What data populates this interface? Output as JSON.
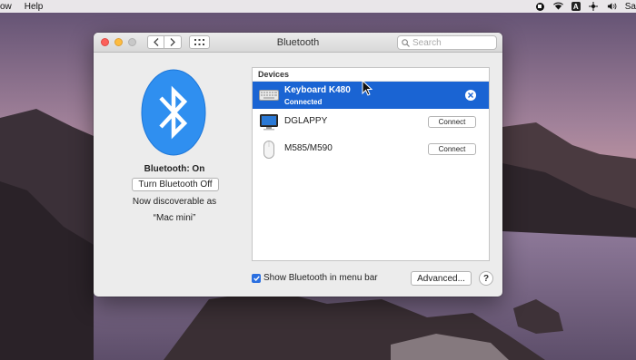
{
  "menubar": {
    "left_items": [
      "ow",
      "Help"
    ],
    "right_text": "Sa",
    "icons": [
      "stop-icon",
      "wifi-icon",
      "input-source-icon",
      "remote-icon",
      "volume-icon"
    ],
    "input_source_letter": "A"
  },
  "window": {
    "title": "Bluetooth",
    "search_placeholder": "Search"
  },
  "bluetooth": {
    "status": "Bluetooth: On",
    "toggle_label": "Turn Bluetooth Off",
    "discoverable_line1": "Now discoverable as",
    "discoverable_line2": "“Mac mini”",
    "logo_color": "#2f8ff0"
  },
  "devices": {
    "header": "Devices",
    "items": [
      {
        "name": "Keyboard K480",
        "status": "Connected",
        "icon": "keyboard-icon",
        "selected": true
      },
      {
        "name": "DGLAPPY",
        "button": "Connect",
        "icon": "computer-icon",
        "selected": false
      },
      {
        "name": "M585/M590",
        "button": "Connect",
        "icon": "mouse-icon",
        "selected": false
      }
    ]
  },
  "footer": {
    "show_in_menu_bar_label": "Show Bluetooth in menu bar",
    "show_in_menu_bar_checked": true,
    "advanced_label": "Advanced...",
    "help_label": "?"
  },
  "colors": {
    "selection": "#1a64d3",
    "checkbox": "#2a6fe0"
  }
}
